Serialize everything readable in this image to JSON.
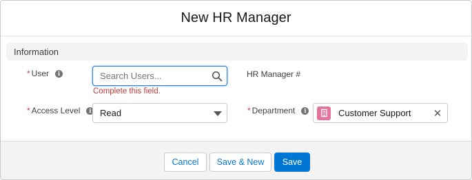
{
  "modal": {
    "title": "New HR Manager"
  },
  "section": {
    "title": "Information"
  },
  "fields": {
    "user": {
      "required_mark": "*",
      "label": "User",
      "placeholder": "Search Users...",
      "value": "",
      "error": "Complete this field.",
      "icon": "search-icon"
    },
    "hr_manager_number": {
      "label": "HR Manager #"
    },
    "access_level": {
      "required_mark": "*",
      "label": "Access Level",
      "value": "Read",
      "icon": "chevron-down-icon"
    },
    "department": {
      "required_mark": "*",
      "label": "Department",
      "value": "Customer Support",
      "icon": "building-icon",
      "clear_icon": "close-icon"
    }
  },
  "info_icon_glyph": "i",
  "footer": {
    "cancel_label": "Cancel",
    "save_new_label": "Save & New",
    "save_label": "Save"
  },
  "colors": {
    "brand": "#0176d3",
    "error": "#c23934",
    "department_icon": "#e3739b"
  }
}
